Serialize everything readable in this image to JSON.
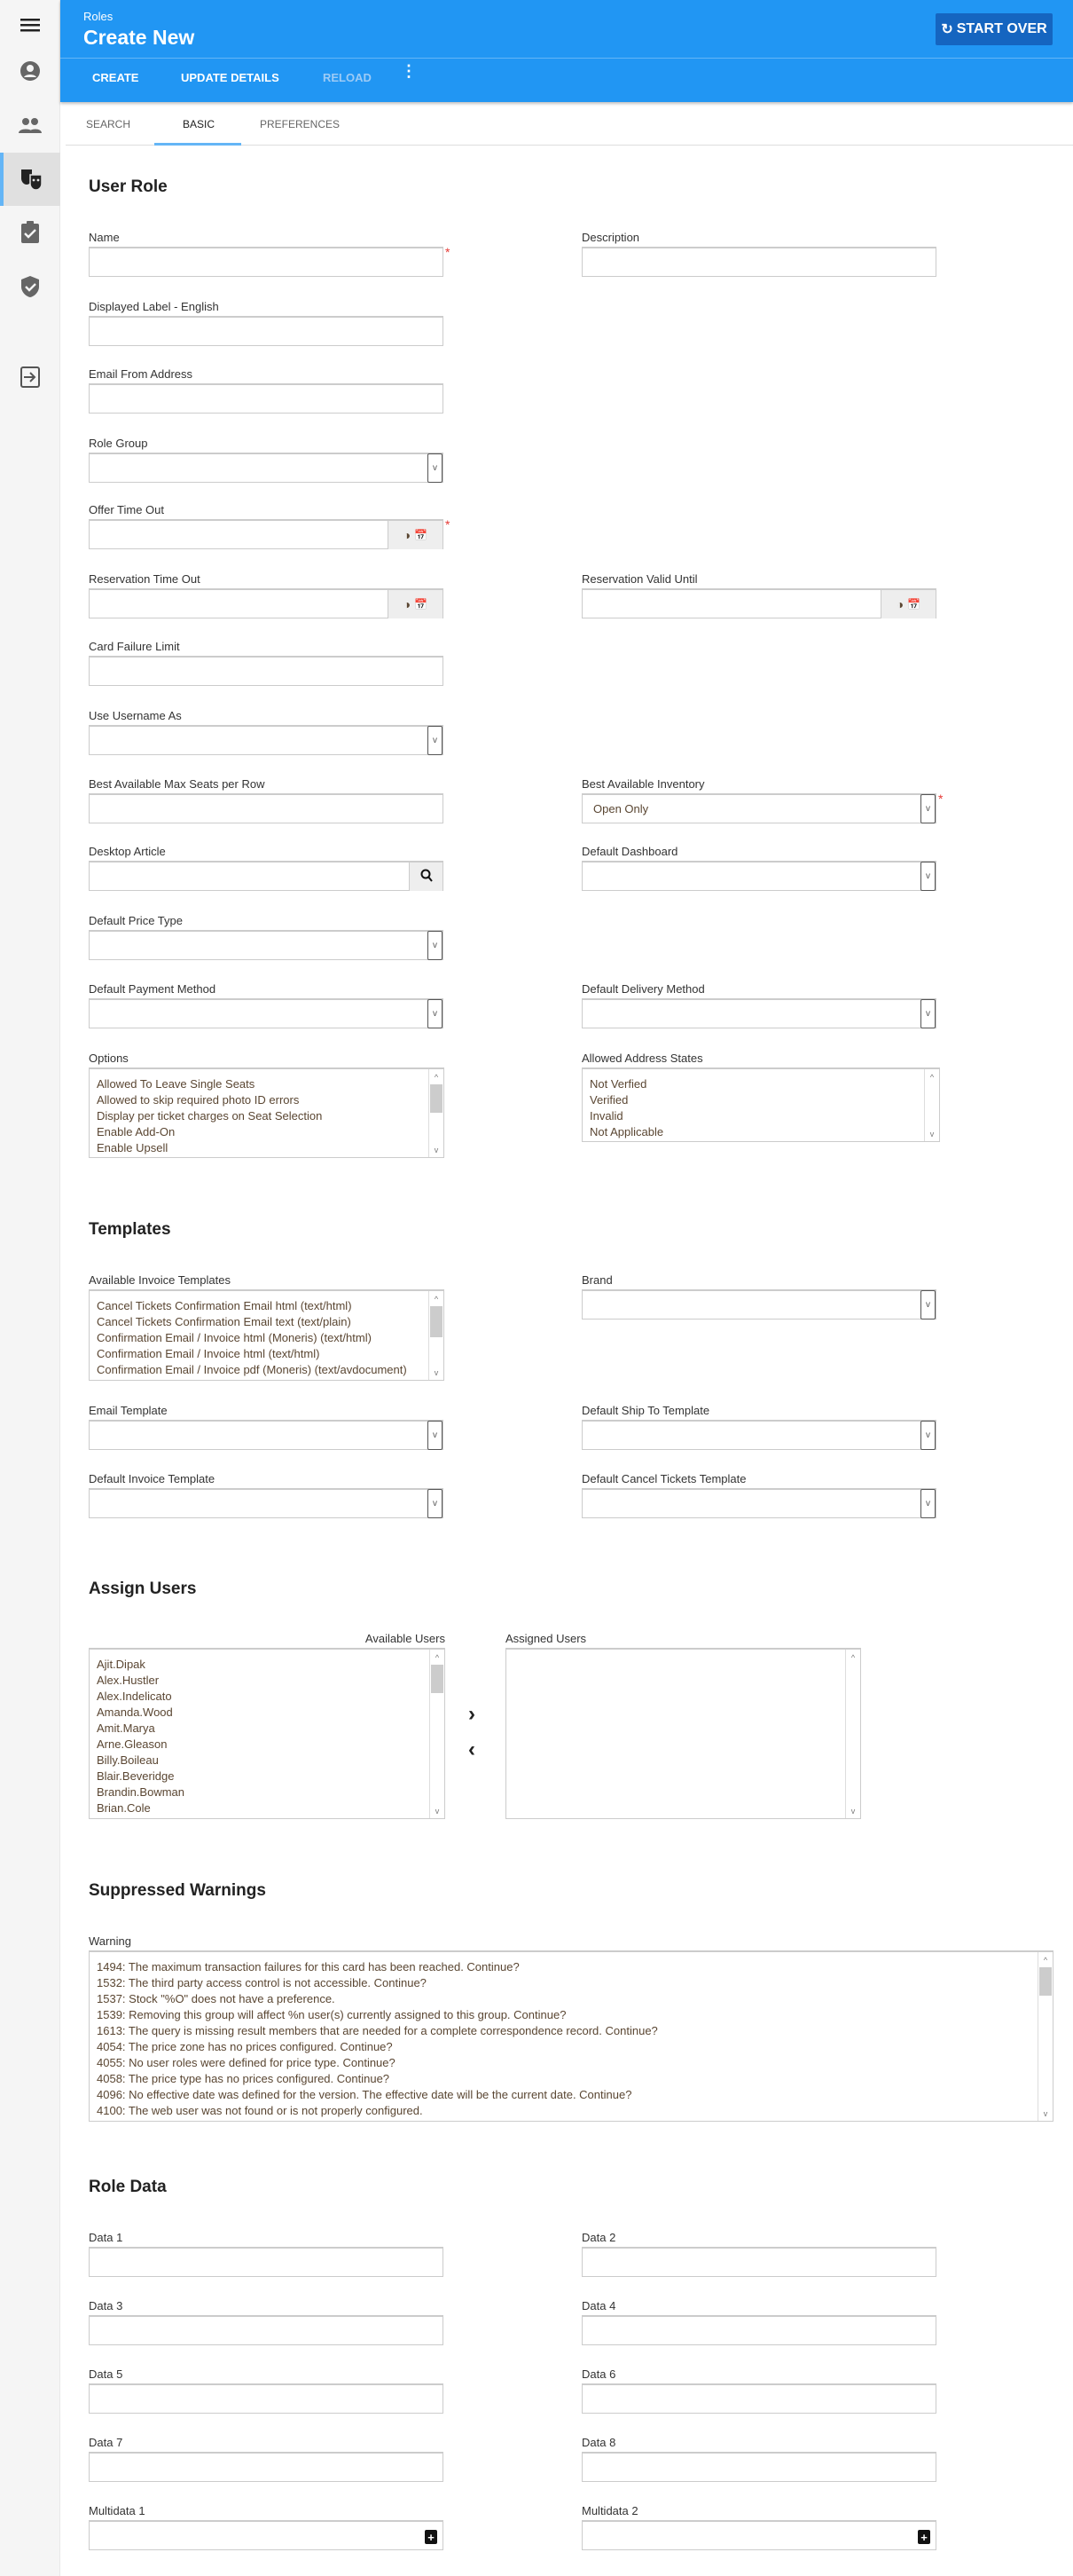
{
  "sidebar": {
    "items": [
      {
        "icon": "menu-icon"
      },
      {
        "icon": "account-icon"
      },
      {
        "icon": "users-icon"
      },
      {
        "icon": "roles-icon",
        "active": true
      },
      {
        "icon": "clipboard-check-icon"
      },
      {
        "icon": "shield-check-icon"
      },
      {
        "icon": "logout-icon"
      }
    ]
  },
  "header": {
    "breadcrumb": "Roles",
    "title": "Create New",
    "start_over": "START OVER",
    "start_over_icon": "refresh-icon"
  },
  "toolbar": {
    "create": "CREATE",
    "update_details": "UPDATE DETAILS",
    "reload": "RELOAD",
    "more_icon": "more-vert-icon"
  },
  "tabs": [
    {
      "label": "SEARCH"
    },
    {
      "label": "BASIC",
      "active": true
    },
    {
      "label": "PREFERENCES"
    }
  ],
  "colors": {
    "primary": "#2196f3",
    "start_over_bg": "#1565c0",
    "required": "#e53935",
    "tab_underline": "#64b5f6"
  },
  "sections": {
    "user_role": "User Role",
    "templates": "Templates",
    "assign_users": "Assign Users",
    "suppressed_warnings": "Suppressed Warnings",
    "role_data": "Role Data"
  },
  "fields": {
    "name": {
      "label": "Name",
      "value": "",
      "required": true
    },
    "description": {
      "label": "Description",
      "value": ""
    },
    "displayed_label": {
      "label": "Displayed Label - English",
      "value": ""
    },
    "email_from": {
      "label": "Email From Address",
      "value": ""
    },
    "role_group": {
      "label": "Role Group",
      "value": ""
    },
    "offer_time_out": {
      "label": "Offer Time Out",
      "value": "",
      "required": true
    },
    "reservation_time_out": {
      "label": "Reservation Time Out",
      "value": ""
    },
    "reservation_valid_until": {
      "label": "Reservation Valid Until",
      "value": ""
    },
    "card_failure_limit": {
      "label": "Card Failure Limit",
      "value": ""
    },
    "use_username_as": {
      "label": "Use Username As",
      "value": ""
    },
    "best_available_max_seats": {
      "label": "Best Available Max Seats per Row",
      "value": ""
    },
    "best_available_inventory": {
      "label": "Best Available Inventory",
      "value": "Open Only",
      "required": true
    },
    "desktop_article": {
      "label": "Desktop Article",
      "value": ""
    },
    "default_dashboard": {
      "label": "Default Dashboard",
      "value": ""
    },
    "default_price_type": {
      "label": "Default Price Type",
      "value": ""
    },
    "default_payment_method": {
      "label": "Default Payment Method",
      "value": ""
    },
    "default_delivery_method": {
      "label": "Default Delivery Method",
      "value": ""
    },
    "options": {
      "label": "Options",
      "items": [
        "Allowed To Leave Single Seats",
        "Allowed to skip required photo ID errors",
        "Display per ticket charges on Seat Selection",
        "Enable Add-On",
        "Enable Upsell"
      ]
    },
    "allowed_address_states": {
      "label": "Allowed Address States",
      "items": [
        "Not Verfied",
        "Verified",
        "Invalid",
        "Not Applicable"
      ]
    },
    "available_invoice_templates": {
      "label": "Available Invoice Templates",
      "items": [
        "Cancel Tickets Confirmation Email html (text/html)",
        "Cancel Tickets Confirmation Email text (text/plain)",
        "Confirmation Email / Invoice html (Moneris) (text/html)",
        "Confirmation Email / Invoice html (text/html)",
        "Confirmation Email / Invoice pdf (Moneris) (text/avdocument)"
      ]
    },
    "brand": {
      "label": "Brand",
      "value": ""
    },
    "email_template": {
      "label": "Email Template",
      "value": ""
    },
    "default_ship_to_template": {
      "label": "Default Ship To Template",
      "value": ""
    },
    "default_invoice_template": {
      "label": "Default Invoice Template",
      "value": ""
    },
    "default_cancel_tickets_template": {
      "label": "Default Cancel Tickets Template",
      "value": ""
    },
    "available_users": {
      "label": "Available Users",
      "items": [
        "Ajit.Dipak",
        "Alex.Hustler",
        "Alex.Indelicato",
        "Amanda.Wood",
        "Amit.Marya",
        "Arne.Gleason",
        "Billy.Boileau",
        "Blair.Beveridge",
        "Brandin.Bowman",
        "Brian.Cole"
      ]
    },
    "assigned_users": {
      "label": "Assigned Users",
      "items": []
    },
    "warning": {
      "label": "Warning",
      "items": [
        "1494: The maximum transaction failures for this card has been reached. Continue?",
        "1532: The third party access control is not accessible. Continue?",
        "1537: Stock \"%O\" does not have a preference.",
        "1539: Removing this group will affect %n user(s) currently assigned to this group. Continue?",
        "1613: The query is missing result members that are needed for a complete correspondence record. Continue?",
        "4054: The price zone has no prices configured. Continue?",
        "4055: No user roles were defined for price type. Continue?",
        "4058: The price type has no prices configured. Continue?",
        "4096: No effective date was defined for the version. The effective date will be the current date. Continue?",
        "4100: The web user was not found or is not properly configured."
      ]
    },
    "data1": {
      "label": "Data 1",
      "value": ""
    },
    "data2": {
      "label": "Data 2",
      "value": ""
    },
    "data3": {
      "label": "Data 3",
      "value": ""
    },
    "data4": {
      "label": "Data 4",
      "value": ""
    },
    "data5": {
      "label": "Data 5",
      "value": ""
    },
    "data6": {
      "label": "Data 6",
      "value": ""
    },
    "data7": {
      "label": "Data 7",
      "value": ""
    },
    "data8": {
      "label": "Data 8",
      "value": ""
    },
    "multidata1": {
      "label": "Multidata 1",
      "value": ""
    },
    "multidata2": {
      "label": "Multidata 2",
      "value": ""
    }
  }
}
